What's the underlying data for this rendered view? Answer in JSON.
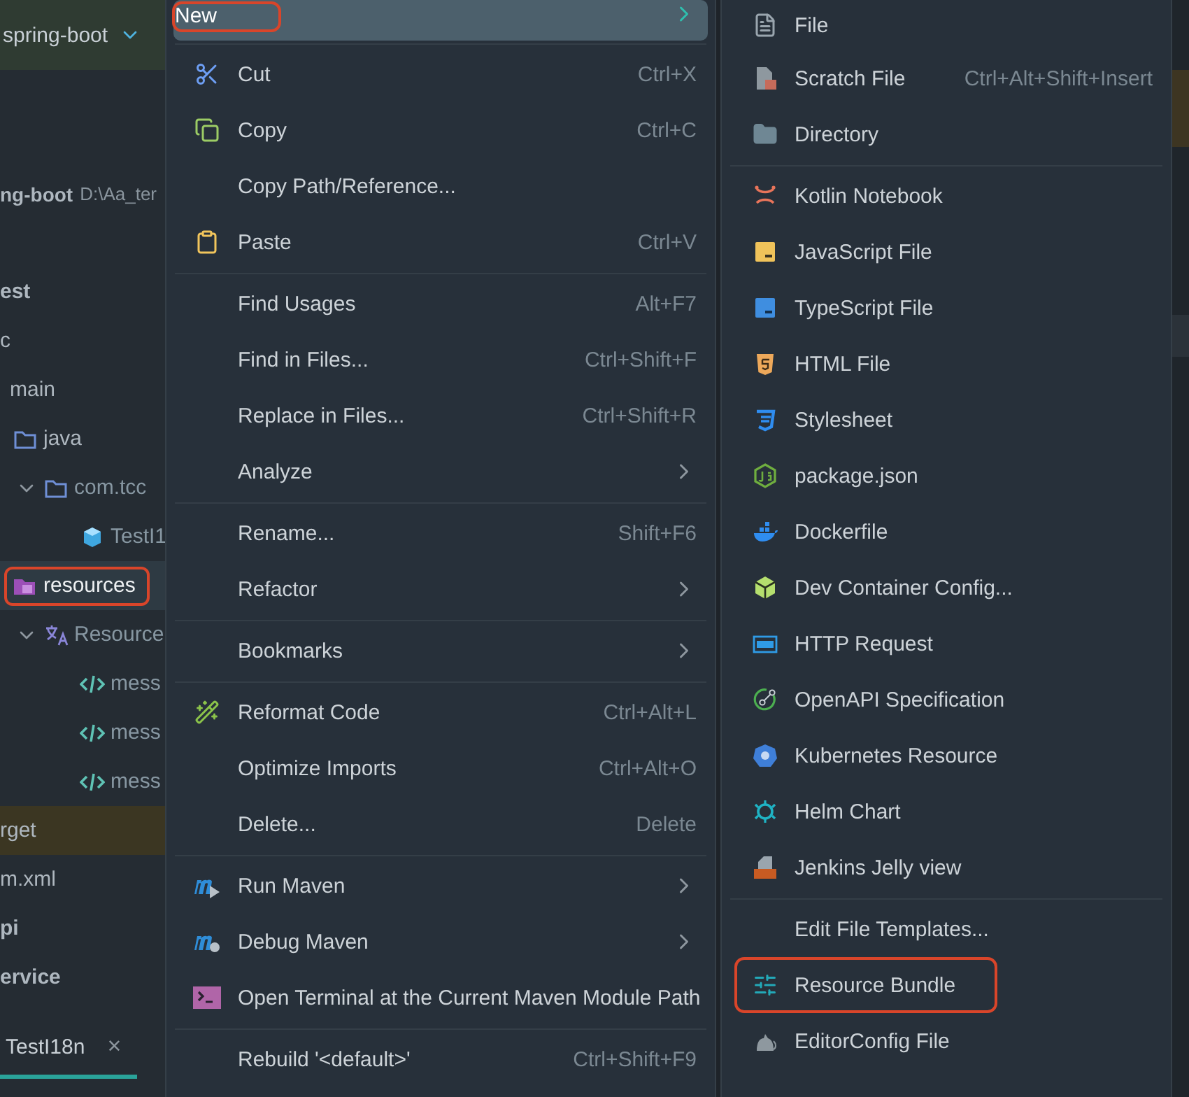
{
  "project_selector": {
    "label": "spring-boot"
  },
  "tree": [
    {
      "label": "ng-boot",
      "path": "D:\\Aa_ter",
      "kind": "project",
      "selected": false,
      "annotated": false,
      "children": [
        {
          "label": "est",
          "kind": "module",
          "selected": false,
          "annotated": false,
          "children": [
            {
              "label": "c",
              "selected": false,
              "annotated": false,
              "children": [
                {
                  "label": "main",
                  "selected": false,
                  "annotated": false,
                  "children": [
                    {
                      "label": "java",
                      "kind": "source-root",
                      "selected": false,
                      "annotated": false,
                      "children": [
                        {
                          "label": "com.tcc",
                          "kind": "package",
                          "expanded": true,
                          "selected": false,
                          "annotated": false,
                          "children": [
                            {
                              "label": "TestI1",
                              "kind": "class",
                              "selected": false,
                              "annotated": false
                            }
                          ]
                        }
                      ]
                    },
                    {
                      "label": "resources",
                      "kind": "resource-root",
                      "selected": true,
                      "annotated": true,
                      "children": [
                        {
                          "label": "Resource",
                          "kind": "bundle",
                          "expanded": true,
                          "selected": false,
                          "annotated": false,
                          "children": [
                            {
                              "label": "mess",
                              "kind": "properties",
                              "selected": false,
                              "annotated": false
                            },
                            {
                              "label": "mess",
                              "kind": "properties",
                              "selected": false,
                              "annotated": false
                            },
                            {
                              "label": "mess",
                              "kind": "properties",
                              "selected": false,
                              "annotated": false
                            }
                          ]
                        }
                      ]
                    }
                  ]
                }
              ]
            },
            {
              "label": "rget",
              "kind": "excluded",
              "selected": false,
              "annotated": false
            },
            {
              "label": "m.xml",
              "selected": false,
              "annotated": false
            }
          ]
        },
        {
          "label": "pi",
          "kind": "module",
          "selected": false,
          "annotated": false
        },
        {
          "label": "ervice",
          "kind": "module",
          "selected": false,
          "annotated": false
        }
      ]
    }
  ],
  "editor_tab": {
    "label": "TestI18n",
    "close": "×"
  },
  "context_menu": {
    "groups": [
      {
        "items": [
          {
            "label": "New",
            "submenu": true,
            "selected": true,
            "annotated": true
          }
        ]
      },
      {
        "items": [
          {
            "label": "Cut",
            "shortcut": "Ctrl+X",
            "selected": false,
            "annotated": false
          },
          {
            "label": "Copy",
            "shortcut": "Ctrl+C",
            "selected": false,
            "annotated": false
          },
          {
            "label": "Copy Path/Reference...",
            "selected": false,
            "annotated": false
          },
          {
            "label": "Paste",
            "shortcut": "Ctrl+V",
            "selected": false,
            "annotated": false
          }
        ]
      },
      {
        "items": [
          {
            "label": "Find Usages",
            "shortcut": "Alt+F7",
            "selected": false,
            "annotated": false
          },
          {
            "label": "Find in Files...",
            "shortcut": "Ctrl+Shift+F",
            "selected": false,
            "annotated": false
          },
          {
            "label": "Replace in Files...",
            "shortcut": "Ctrl+Shift+R",
            "selected": false,
            "annotated": false
          },
          {
            "label": "Analyze",
            "submenu": true,
            "selected": false,
            "annotated": false
          }
        ]
      },
      {
        "items": [
          {
            "label": "Rename...",
            "shortcut": "Shift+F6",
            "selected": false,
            "annotated": false
          },
          {
            "label": "Refactor",
            "submenu": true,
            "selected": false,
            "annotated": false
          }
        ]
      },
      {
        "items": [
          {
            "label": "Bookmarks",
            "submenu": true,
            "selected": false,
            "annotated": false
          }
        ]
      },
      {
        "items": [
          {
            "label": "Reformat Code",
            "shortcut": "Ctrl+Alt+L",
            "selected": false,
            "annotated": false
          },
          {
            "label": "Optimize Imports",
            "shortcut": "Ctrl+Alt+O",
            "selected": false,
            "annotated": false
          },
          {
            "label": "Delete...",
            "shortcut": "Delete",
            "selected": false,
            "annotated": false
          }
        ]
      },
      {
        "items": [
          {
            "label": "Run Maven",
            "submenu": true,
            "selected": false,
            "annotated": false
          },
          {
            "label": "Debug Maven",
            "submenu": true,
            "selected": false,
            "annotated": false
          },
          {
            "label": "Open Terminal at the Current Maven Module Path",
            "selected": false,
            "annotated": false
          }
        ]
      },
      {
        "items": [
          {
            "label": "Rebuild '<default>'",
            "shortcut": "Ctrl+Shift+F9",
            "selected": false,
            "annotated": false
          }
        ]
      }
    ]
  },
  "new_submenu": {
    "groups": [
      {
        "items": [
          {
            "label": "File",
            "selected": false,
            "annotated": false
          },
          {
            "label": "Scratch File",
            "shortcut": "Ctrl+Alt+Shift+Insert",
            "selected": false,
            "annotated": false
          },
          {
            "label": "Directory",
            "selected": false,
            "annotated": false
          }
        ]
      },
      {
        "items": [
          {
            "label": "Kotlin Notebook",
            "selected": false,
            "annotated": false
          },
          {
            "label": "JavaScript File",
            "selected": false,
            "annotated": false
          },
          {
            "label": "TypeScript File",
            "selected": false,
            "annotated": false
          },
          {
            "label": "HTML File",
            "selected": false,
            "annotated": false
          },
          {
            "label": "Stylesheet",
            "selected": false,
            "annotated": false
          },
          {
            "label": "package.json",
            "selected": false,
            "annotated": false
          },
          {
            "label": "Dockerfile",
            "selected": false,
            "annotated": false
          },
          {
            "label": "Dev Container Config...",
            "selected": false,
            "annotated": false
          },
          {
            "label": "HTTP Request",
            "selected": false,
            "annotated": false
          },
          {
            "label": "OpenAPI Specification",
            "selected": false,
            "annotated": false
          },
          {
            "label": "Kubernetes Resource",
            "selected": false,
            "annotated": false
          },
          {
            "label": "Helm Chart",
            "selected": false,
            "annotated": false
          },
          {
            "label": "Jenkins Jelly view",
            "selected": false,
            "annotated": false
          }
        ]
      },
      {
        "items": [
          {
            "label": "Edit File Templates...",
            "selected": false,
            "annotated": false
          },
          {
            "label": "Resource Bundle",
            "selected": false,
            "annotated": true
          },
          {
            "label": "EditorConfig File",
            "selected": false,
            "annotated": false
          }
        ]
      }
    ]
  }
}
